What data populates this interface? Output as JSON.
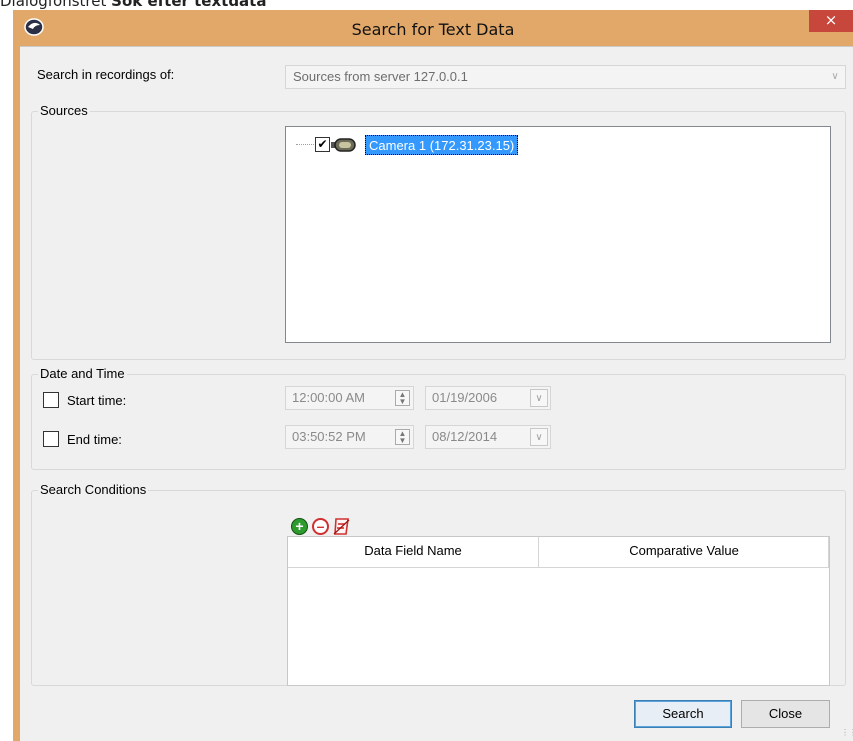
{
  "page_caption": {
    "prefix": "Dialogfönstret ",
    "bold": "Sök efter textdata"
  },
  "window": {
    "title": "Search for Text Data",
    "close_glyph": "×",
    "app_icon": "app-logo-icon",
    "frame_color": "#e1a86a",
    "close_color": "#c7473c"
  },
  "search_in": {
    "label": "Search in recordings of:",
    "value": "Sources from server 127.0.0.1"
  },
  "sources": {
    "group_title": "Sources",
    "tree": [
      {
        "label": "Camera 1 (172.31.23.15)",
        "checked": true,
        "selected": true,
        "icon": "camera-icon"
      }
    ]
  },
  "date_time": {
    "group_title": "Date and Time",
    "start": {
      "label": "Start time:",
      "checked": false,
      "time": "12:00:00 AM",
      "date": "01/19/2006"
    },
    "end": {
      "label": "End time:",
      "checked": false,
      "time": "03:50:52 PM",
      "date": "08/12/2014"
    }
  },
  "search_conditions": {
    "group_title": "Search Conditions",
    "toolbar": {
      "add_icon": "add-condition-icon",
      "remove_icon": "remove-condition-icon",
      "clear_icon": "clear-conditions-icon"
    },
    "columns": [
      "Data Field Name",
      "Comparative Value"
    ],
    "rows": []
  },
  "buttons": {
    "search": "Search",
    "close": "Close"
  },
  "colors": {
    "selection": "#3399ff",
    "add_green": "#2e9b2e",
    "remove_red": "#d03030"
  }
}
